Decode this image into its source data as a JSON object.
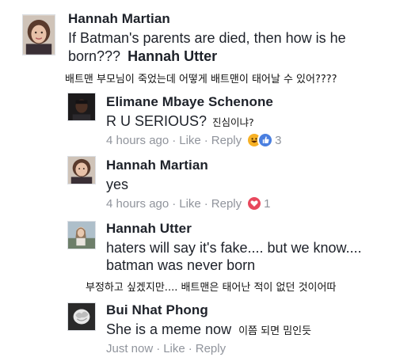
{
  "comments": [
    {
      "name": "Hannah Martian",
      "text": "If Batman's parents are died, then how is he",
      "text2": "born???",
      "tag": "Hannah Utter",
      "translation": "배트맨 부모님이 죽었는데 어떻게 배트맨이 태어날 수 있어????"
    },
    {
      "name": "Elimane Mbaye Schenone",
      "text": "R U SERIOUS?",
      "translation": "진심이냐?",
      "time": "4 hours ago",
      "like": "Like",
      "reply": "Reply",
      "reaction_count": "3",
      "reaction_colors": {
        "haha": "#f7b125",
        "like": "#4a7fe0"
      }
    },
    {
      "name": "Hannah Martian",
      "text": "yes",
      "time": "4 hours ago",
      "like": "Like",
      "reply": "Reply",
      "reaction_count": "1",
      "reaction_colors": {
        "love": "#e8485d"
      }
    },
    {
      "name": "Hannah Utter",
      "text": "haters will say it's fake.... but we know....",
      "text2": "batman was never born",
      "translation": "부정하고 싶겠지만.... 배트맨은 태어난 적이 없던 것이어따"
    },
    {
      "name": "Bui Nhat Phong",
      "text": "She is a meme now",
      "translation": "이쯤 되면 밈인듯",
      "time": "Just now",
      "like": "Like",
      "reply": "Reply"
    }
  ],
  "separator": "·"
}
